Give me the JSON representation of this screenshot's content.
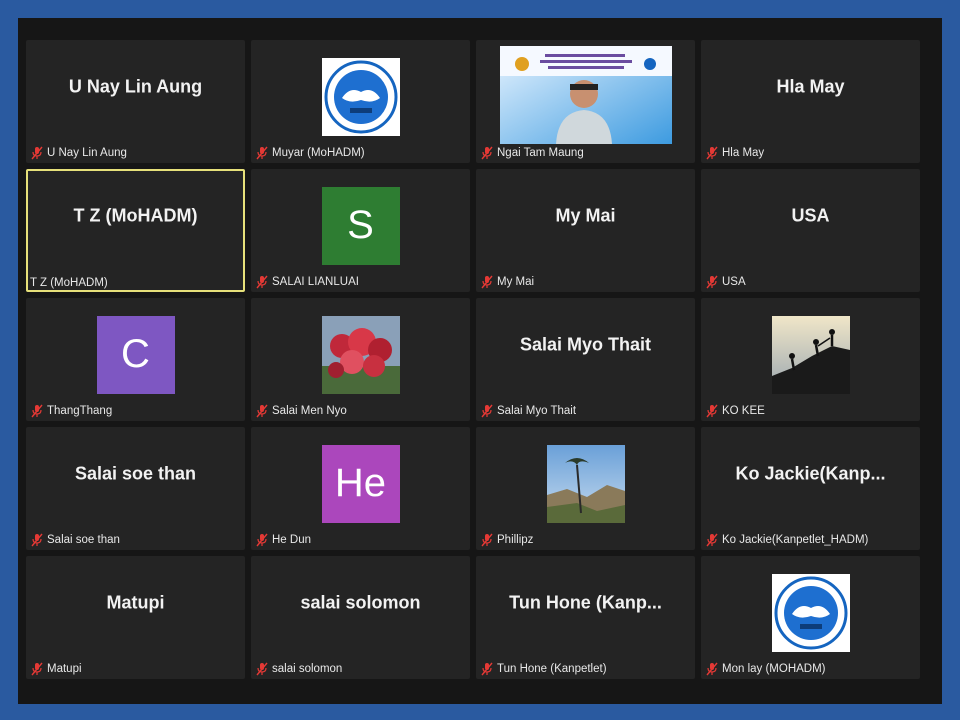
{
  "participants": [
    {
      "display": "U Nay Lin Aung",
      "label": "U Nay Lin Aung",
      "muted": true
    },
    {
      "display": "",
      "label": "Muyar (MoHADM)",
      "muted": true,
      "avatar_type": "logo"
    },
    {
      "display": "",
      "label": "Ngai Tam Maung",
      "muted": true,
      "avatar_type": "video"
    },
    {
      "display": "Hla May",
      "label": "Hla May",
      "muted": true
    },
    {
      "display": "T Z (MoHADM)",
      "label": "T Z (MoHADM)",
      "muted": false,
      "active_speaker": true
    },
    {
      "display": "",
      "label": "SALAI LIANLUAI",
      "muted": true,
      "avatar_type": "letter",
      "letter": "S",
      "color": "#2e7d32"
    },
    {
      "display": "My Mai",
      "label": "My Mai",
      "muted": true
    },
    {
      "display": "USA",
      "label": "USA",
      "muted": true
    },
    {
      "display": "",
      "label": "ThangThang",
      "muted": true,
      "avatar_type": "letter",
      "letter": "C",
      "color": "#7e57c2"
    },
    {
      "display": "",
      "label": "Salai Men Nyo",
      "muted": true,
      "avatar_type": "photo-flowers"
    },
    {
      "display": "Salai Myo Thait",
      "label": "Salai Myo Thait",
      "muted": true
    },
    {
      "display": "",
      "label": "KO KEE",
      "muted": true,
      "avatar_type": "photo-climbers"
    },
    {
      "display": "Salai soe than",
      "label": "Salai soe than",
      "muted": true
    },
    {
      "display": "",
      "label": "He Dun",
      "muted": true,
      "avatar_type": "letter",
      "letter": "He",
      "color": "#ab47bc"
    },
    {
      "display": "",
      "label": "Phillipz",
      "muted": true,
      "avatar_type": "photo-landscape"
    },
    {
      "display": "Ko  Jackie(Kanp...",
      "label": "Ko Jackie(Kanpetlet_HADM)",
      "muted": true
    },
    {
      "display": "Matupi",
      "label": "Matupi",
      "muted": true
    },
    {
      "display": "salai solomon",
      "label": "salai solomon",
      "muted": true
    },
    {
      "display": "Tun Hone (Kanp...",
      "label": "Tun Hone (Kanpetlet)",
      "muted": true
    },
    {
      "display": "",
      "label": "Mon lay (MOHADM)",
      "muted": true,
      "avatar_type": "logo"
    }
  ],
  "logo_text": "MOHADM",
  "colors": {
    "mic_muted": "#e53935",
    "active_border": "#e6e07a",
    "background": "#2a5aa0"
  },
  "icons": {
    "muted": "microphone-muted-icon"
  }
}
